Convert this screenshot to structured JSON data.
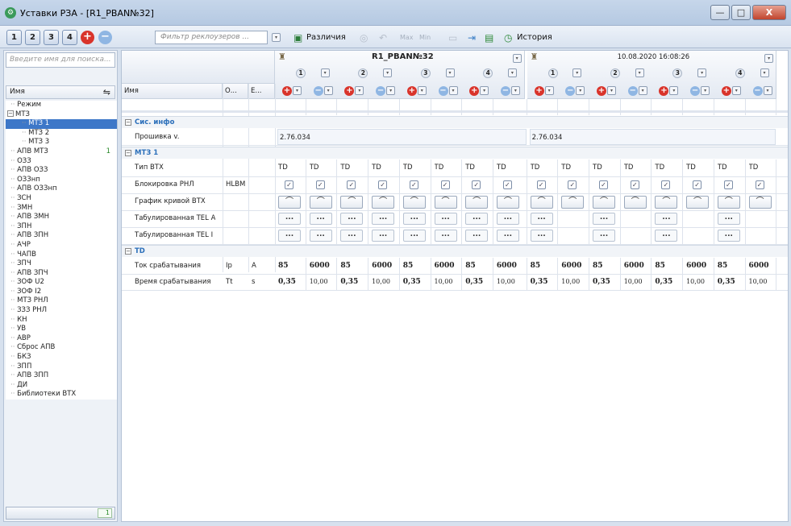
{
  "window": {
    "title": "Уставки РЗА - [R1_PBAN№32]",
    "min_glyph": "—",
    "max_glyph": "□",
    "close_glyph": "X"
  },
  "toolbar": {
    "tabs": [
      "1",
      "2",
      "3",
      "4"
    ],
    "filter_placeholder": "Фильтр реклоузеров ...",
    "diff_label": "Различия",
    "max_label": "Max",
    "min_label": "Min",
    "history_label": "История"
  },
  "sidebar": {
    "search_placeholder": "Введите имя для поиска...",
    "tree_header": "Имя",
    "footer_count": "1",
    "items": [
      {
        "label": "Режим",
        "indent": 1
      },
      {
        "label": "МТЗ",
        "indent": 0,
        "box": "−"
      },
      {
        "label": "МТЗ 1",
        "indent": 2,
        "selected": true
      },
      {
        "label": "МТЗ 2",
        "indent": 2
      },
      {
        "label": "МТЗ 3",
        "indent": 2
      },
      {
        "label": "АПВ МТЗ",
        "indent": 1,
        "count": "1"
      },
      {
        "label": "ОЗЗ",
        "indent": 1
      },
      {
        "label": "АПВ ОЗЗ",
        "indent": 1
      },
      {
        "label": "ОЗЗнп",
        "indent": 1
      },
      {
        "label": "АПВ ОЗЗнп",
        "indent": 1
      },
      {
        "label": "ЗСН",
        "indent": 1
      },
      {
        "label": "ЗМН",
        "indent": 1
      },
      {
        "label": "АПВ ЗМН",
        "indent": 1
      },
      {
        "label": "ЗПН",
        "indent": 1
      },
      {
        "label": "АПВ ЗПН",
        "indent": 1
      },
      {
        "label": "АЧР",
        "indent": 1
      },
      {
        "label": "ЧАПВ",
        "indent": 1
      },
      {
        "label": "ЗПЧ",
        "indent": 1
      },
      {
        "label": "АПВ ЗПЧ",
        "indent": 1
      },
      {
        "label": "ЗОФ U2",
        "indent": 1
      },
      {
        "label": "ЗОФ I2",
        "indent": 1
      },
      {
        "label": "МТЗ РНЛ",
        "indent": 1
      },
      {
        "label": "ЗЗЗ РНЛ",
        "indent": 1
      },
      {
        "label": "КН",
        "indent": 1
      },
      {
        "label": "УВ",
        "indent": 1
      },
      {
        "label": "АВР",
        "indent": 1
      },
      {
        "label": "Сброс АПВ",
        "indent": 1
      },
      {
        "label": "БКЗ",
        "indent": 1
      },
      {
        "label": "ЗПП",
        "indent": 1
      },
      {
        "label": "АПВ ЗПП",
        "indent": 1
      },
      {
        "label": "ДИ",
        "indent": 1
      },
      {
        "label": "Библиотеки ВТХ",
        "indent": 1
      }
    ]
  },
  "grid": {
    "col_name": "Имя",
    "col_o": "О...",
    "col_e": "Е...",
    "device1_title": "R1_PBAN№32",
    "device2_title": "10.08.2020 16:08:26",
    "group_numbers": [
      "1",
      "2",
      "3",
      "4"
    ],
    "sections": {
      "sys": "Сис. инфо",
      "mtz1": "МТЗ 1",
      "td": "TD"
    },
    "rows": {
      "firmware": {
        "name": "Прошивка v.",
        "value1": "2.76.034",
        "value2": "2.76.034"
      },
      "vtx_type": {
        "name": "Тип ВТХ",
        "values": [
          "TD",
          "TD",
          "TD",
          "TD",
          "TD",
          "TD",
          "TD",
          "TD",
          "TD",
          "TD",
          "TD",
          "TD",
          "TD",
          "TD",
          "TD",
          "TD"
        ]
      },
      "rnl_block": {
        "name": "Блокировка РНЛ",
        "o": "HLBM"
      },
      "curve": {
        "name": "График кривой ВТХ"
      },
      "tel_a": {
        "name": "Табулированная TEL A"
      },
      "tel_i": {
        "name": "Табулированная TEL I"
      },
      "pickup": {
        "name": "Ток срабатывания",
        "o": "Ip",
        "e": "A",
        "values": [
          "85",
          "6000",
          "85",
          "6000",
          "85",
          "6000",
          "85",
          "6000",
          "85",
          "6000",
          "85",
          "6000",
          "85",
          "6000",
          "85",
          "6000"
        ]
      },
      "trip_time": {
        "name": "Время срабатывания",
        "o": "Tt",
        "e": "s",
        "values": [
          "0,35",
          "10,00",
          "0,35",
          "10,00",
          "0,35",
          "10,00",
          "0,35",
          "10,00",
          "0,35",
          "10,00",
          "0,35",
          "10,00",
          "0,35",
          "10,00",
          "0,35",
          "10,00"
        ]
      }
    },
    "glyphs": {
      "check": "✓",
      "curve": "⌒",
      "dots": "...",
      "plus": "+",
      "minus": "−",
      "dropdown": "▾"
    }
  }
}
